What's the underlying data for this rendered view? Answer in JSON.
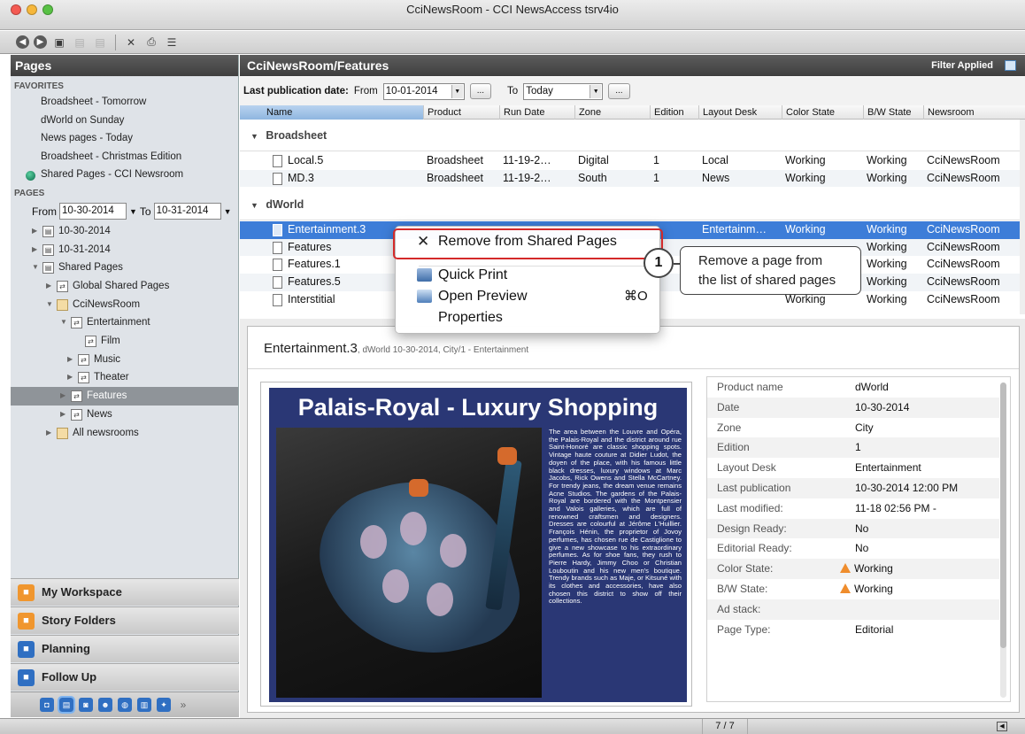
{
  "window": {
    "title": "CciNewsRoom - CCI NewsAccess tsrv4io"
  },
  "left": {
    "header": "Pages",
    "favorites_label": "FAVORITES",
    "favorites": [
      "Broadsheet - Tomorrow",
      "dWorld on Sunday",
      "News pages - Today",
      "Broadsheet - Christmas Edition",
      "Shared Pages - CCI Newsroom"
    ],
    "pages_label": "PAGES",
    "from_label": "From",
    "from_value": "10-30-2014",
    "to_label": "To",
    "to_value": "10-31-2014",
    "tree": [
      {
        "label": "10-30-2014",
        "depth": 0,
        "icon": "page-icon",
        "expand": "collapsed"
      },
      {
        "label": "10-31-2014",
        "depth": 0,
        "icon": "page-icon",
        "expand": "collapsed"
      },
      {
        "label": "Shared Pages",
        "depth": 0,
        "icon": "page-icon",
        "expand": "expanded"
      },
      {
        "label": "Global Shared Pages",
        "depth": 1,
        "icon": "shared-icon",
        "expand": "collapsed"
      },
      {
        "label": "CciNewsRoom",
        "depth": 1,
        "icon": "folder-icon",
        "expand": "expanded"
      },
      {
        "label": "Entertainment",
        "depth": 2,
        "icon": "shared-icon",
        "expand": "expanded"
      },
      {
        "label": "Film",
        "depth": 3,
        "icon": "shared-icon",
        "expand": "none"
      },
      {
        "label": "Music",
        "depth": 2.5,
        "icon": "shared-icon",
        "expand": "collapsed"
      },
      {
        "label": "Theater",
        "depth": 2.5,
        "icon": "shared-icon",
        "expand": "collapsed"
      },
      {
        "label": "Features",
        "depth": 2,
        "icon": "shared-icon",
        "expand": "collapsed",
        "selected": true
      },
      {
        "label": "News",
        "depth": 2,
        "icon": "shared-icon",
        "expand": "collapsed"
      },
      {
        "label": "All newsrooms",
        "depth": 1,
        "icon": "folder-icon",
        "expand": "collapsed"
      }
    ],
    "nav": [
      {
        "label": "My Workspace",
        "icon": "workspace-icon",
        "color": "#f0962e"
      },
      {
        "label": "Story Folders",
        "icon": "story-folders-icon",
        "color": "#f0962e"
      },
      {
        "label": "Planning",
        "icon": "planning-icon",
        "color": "#2f6fc2"
      },
      {
        "label": "Follow Up",
        "icon": "follow-up-icon",
        "color": "#2f6fc2"
      }
    ]
  },
  "main": {
    "header": "CciNewsRoom/Features",
    "filter_status": "Filter Applied",
    "filter": {
      "label": "Last publication date:",
      "from_label": "From",
      "from_value": "10-01-2014",
      "to_label": "To",
      "to_value": "Today",
      "btn": "..."
    },
    "columns": [
      "Name",
      "Product",
      "Run Date",
      "Zone",
      "Edition",
      "Layout Desk",
      "Color State",
      "B/W State",
      "Newsroom"
    ],
    "groups": [
      {
        "name": "Broadsheet",
        "rows": [
          [
            "Local.5",
            "Broadsheet",
            "11-19-2…",
            "Digital",
            "1",
            "Local",
            "Working",
            "Working",
            "CciNewsRoom"
          ],
          [
            "MD.3",
            "Broadsheet",
            "11-19-2…",
            "South",
            "1",
            "News",
            "Working",
            "Working",
            "CciNewsRoom"
          ]
        ]
      },
      {
        "name": "dWorld",
        "rows": [
          [
            "Entertainment.3",
            "",
            "",
            "",
            "",
            "Entertainm…",
            "Working",
            "Working",
            "CciNewsRoom"
          ],
          [
            "Features",
            "",
            "",
            "",
            "",
            "",
            "",
            "Working",
            "CciNewsRoom"
          ],
          [
            "Features.1",
            "",
            "",
            "",
            "",
            "",
            "",
            "Working",
            "CciNewsRoom"
          ],
          [
            "Features.5",
            "",
            "",
            "",
            "",
            "",
            "",
            "Working",
            "CciNewsRoom"
          ],
          [
            "Interstitial",
            "",
            "",
            "",
            "",
            "",
            "Working",
            "Working",
            "CciNewsRoom"
          ]
        ]
      }
    ]
  },
  "context_menu": {
    "remove": "Remove from Shared Pages",
    "quick_print": "Quick Print",
    "open_preview": "Open Preview",
    "open_preview_shortcut": "⌘O",
    "properties": "Properties"
  },
  "callout": {
    "number": "1",
    "line1": "Remove a page from",
    "line2": "the list of shared pages"
  },
  "preview": {
    "title": "Entertainment.3",
    "subtitle": ", dWorld 10-30-2014, City/1 - Entertainment",
    "article_headline": "Palais-Royal - Luxury Shopping",
    "article_text": "The area between the Louvre and Opéra, the Palais-Royal and the district around rue Saint-Honoré are classic shopping spots. Vintage haute couture at Didier Ludot, the doyen of the place, with his famous little black dresses, luxury windows at Marc Jacobs, Rick Owens and Stella McCartney. For trendy jeans, the dream venue remains Acne Studios. The gardens of the Palais-Royal are bordered with the Montpensier and Valois galleries, which are full of renowned craftsmen and designers. Dresses are colourful at Jérôme L'Huillier. François Hénin, the proprietor of Jovoy perfumes, has chosen rue de Castiglione to give a new showcase to his extraordinary perfumes. As for shoe fans, they rush to Pierre Hardy, Jimmy Choo or Christian Louboutin and his new men's boutique. Trendy brands such as Maje, or Kitsuné with its clothes and accessories, have also chosen this district to show off their collections.",
    "props": [
      [
        "Product name",
        "dWorld"
      ],
      [
        "Date",
        "10-30-2014"
      ],
      [
        "Zone",
        "City"
      ],
      [
        "Edition",
        "1"
      ],
      [
        "Layout Desk",
        "Entertainment"
      ],
      [
        "Last publication",
        "10-30-2014 12:00 PM"
      ],
      [
        "Last modified:",
        "11-18 02:56 PM -"
      ],
      [
        "Design Ready:",
        "No"
      ],
      [
        "Editorial Ready:",
        "No"
      ],
      [
        "Color State:",
        "Working"
      ],
      [
        "B/W State:",
        "Working"
      ],
      [
        "Ad stack:",
        ""
      ],
      [
        "Page Type:",
        "Editorial"
      ]
    ]
  },
  "status": {
    "page_counter": "7 / 7"
  },
  "colors": {
    "selection": "#3d7dd8",
    "header_dark": "#4a4a4a",
    "warning": "#ef8d2d",
    "highlight_border": "#d42a2a"
  }
}
